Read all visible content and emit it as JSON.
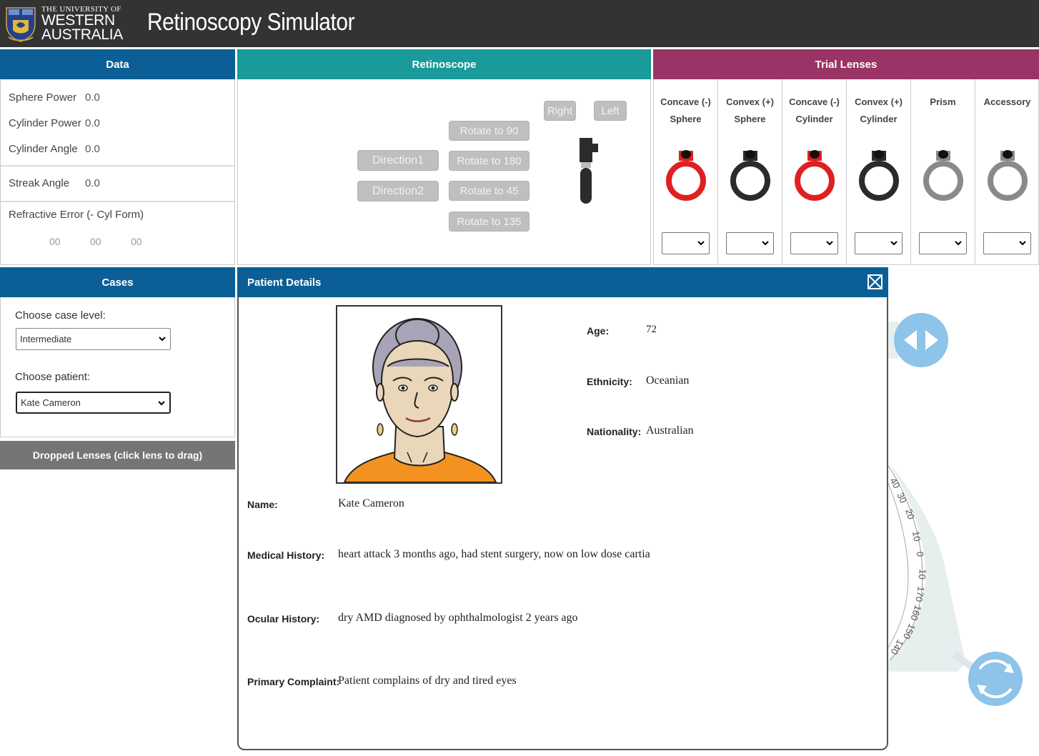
{
  "header": {
    "uni_line1": "THE UNIVERSITY OF",
    "uni_line2": "WESTERN",
    "uni_line3": "AUSTRALIA",
    "app_title": "Retinoscopy Simulator"
  },
  "data_panel": {
    "title": "Data",
    "sphere_power_label": "Sphere Power",
    "sphere_power_value": "0.0",
    "cylinder_power_label": "Cylinder Power",
    "cylinder_power_value": "0.0",
    "cylinder_angle_label": "Cylinder Angle",
    "cylinder_angle_value": "0.0",
    "streak_angle_label": "Streak Angle",
    "streak_angle_value": "0.0",
    "refractive_error_label": "Refractive Error  (- Cyl Form)",
    "refractive_values": [
      "00",
      "00",
      "00"
    ]
  },
  "retinoscope": {
    "title": "Retinoscope",
    "right_label": "Right",
    "left_label": "Left",
    "rotate_90": "Rotate to 90",
    "rotate_180": "Rotate to 180",
    "rotate_45": "Rotate to 45",
    "rotate_135": "Rotate to 135",
    "direction1": "Direction1",
    "direction2": "Direction2"
  },
  "trial_lenses": {
    "title": "Trial Lenses",
    "columns": [
      {
        "line1": "Concave (-)",
        "line2": "Sphere",
        "color": "#e02020"
      },
      {
        "line1": "Convex (+)",
        "line2": "Sphere",
        "color": "#2b2b2b"
      },
      {
        "line1": "Concave (-)",
        "line2": "Cylinder",
        "color": "#e02020"
      },
      {
        "line1": "Convex (+)",
        "line2": "Cylinder",
        "color": "#2b2b2b"
      },
      {
        "line1": "Prism",
        "line2": "",
        "color": "#8a8a8a"
      },
      {
        "line1": "Accessory",
        "line2": "",
        "color": "#8a8a8a"
      }
    ]
  },
  "cases": {
    "title": "Cases",
    "case_level_label": "Choose case level:",
    "case_level_value": "Intermediate",
    "patient_label": "Choose patient:",
    "patient_value": "Kate Cameron",
    "dropped_lenses": "Dropped Lenses (click lens to drag)"
  },
  "patient": {
    "title": "Patient Details",
    "age_label": "Age:",
    "age_value": "72",
    "ethnicity_label": "Ethnicity:",
    "ethnicity_value": "Oceanian",
    "nationality_label": "Nationality:",
    "nationality_value": "Australian",
    "name_label": "Name:",
    "name_value": "Kate Cameron",
    "medical_label": "Medical History:",
    "medical_value": "heart attack 3 months ago, had stent surgery, now on low dose cartia",
    "ocular_label": "Ocular History:",
    "ocular_value": "dry AMD diagnosed by ophthalmologist 2 years ago",
    "complaint_label": "Primary Complaint:",
    "complaint_value": "Patient complains of dry and tired eyes"
  },
  "stage": {
    "dial_ticks": [
      "40",
      "30",
      "20",
      "10",
      "0",
      "10",
      "170",
      "160",
      "150",
      "140"
    ],
    "accent": "#8ec3ea"
  }
}
